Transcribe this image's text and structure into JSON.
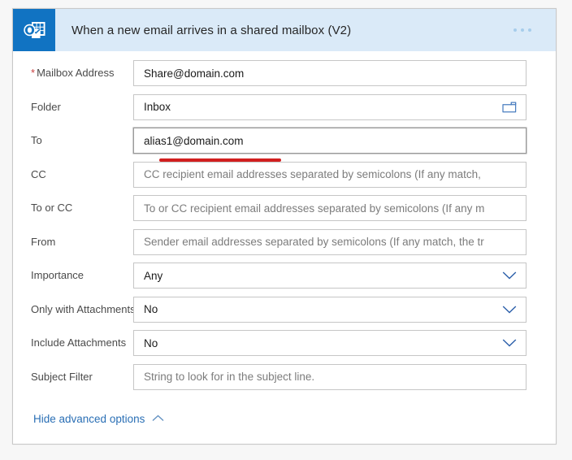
{
  "header": {
    "title": "When a new email arrives in a shared mailbox (V2)",
    "icon_name": "outlook-icon",
    "menu_icon_name": "more-options-icon",
    "background_color": "#daeaf8",
    "icon_background_color": "#1173c2"
  },
  "fields": [
    {
      "label": "Mailbox Address",
      "required": true,
      "value": "Share@domain.com",
      "placeholder": "",
      "control": "text",
      "trailing_icon": "",
      "focused": false
    },
    {
      "label": "Folder",
      "required": false,
      "value": "Inbox",
      "placeholder": "",
      "control": "text",
      "trailing_icon": "folder-picker-icon",
      "focused": false
    },
    {
      "label": "To",
      "required": false,
      "value": "alias1@domain.com",
      "placeholder": "",
      "control": "text",
      "trailing_icon": "",
      "focused": true
    },
    {
      "label": "CC",
      "required": false,
      "value": "",
      "placeholder": "CC recipient email addresses separated by semicolons (If any match,",
      "control": "text",
      "trailing_icon": "",
      "focused": false
    },
    {
      "label": "To or CC",
      "required": false,
      "value": "",
      "placeholder": "To or CC recipient email addresses separated by semicolons (If any m",
      "control": "text",
      "trailing_icon": "",
      "focused": false
    },
    {
      "label": "From",
      "required": false,
      "value": "",
      "placeholder": "Sender email addresses separated by semicolons (If any match, the tr",
      "control": "text",
      "trailing_icon": "",
      "focused": false
    },
    {
      "label": "Importance",
      "required": false,
      "value": "Any",
      "placeholder": "",
      "control": "dropdown",
      "trailing_icon": "chevron-down-icon",
      "focused": false
    },
    {
      "label": "Only with Attachments",
      "required": false,
      "value": "No",
      "placeholder": "",
      "control": "dropdown",
      "trailing_icon": "chevron-down-icon",
      "focused": false
    },
    {
      "label": "Include Attachments",
      "required": false,
      "value": "No",
      "placeholder": "",
      "control": "dropdown",
      "trailing_icon": "chevron-down-icon",
      "focused": false
    },
    {
      "label": "Subject Filter",
      "required": false,
      "value": "",
      "placeholder": "String to look for in the subject line.",
      "control": "text",
      "trailing_icon": "",
      "focused": false
    }
  ],
  "footer": {
    "advanced_options_label": "Hide advanced options",
    "advanced_options_icon": "chevron-up-icon",
    "link_color": "#2a6fb5"
  },
  "annotation": {
    "type": "underline",
    "color": "#d21f1f",
    "targets_field": "To"
  }
}
